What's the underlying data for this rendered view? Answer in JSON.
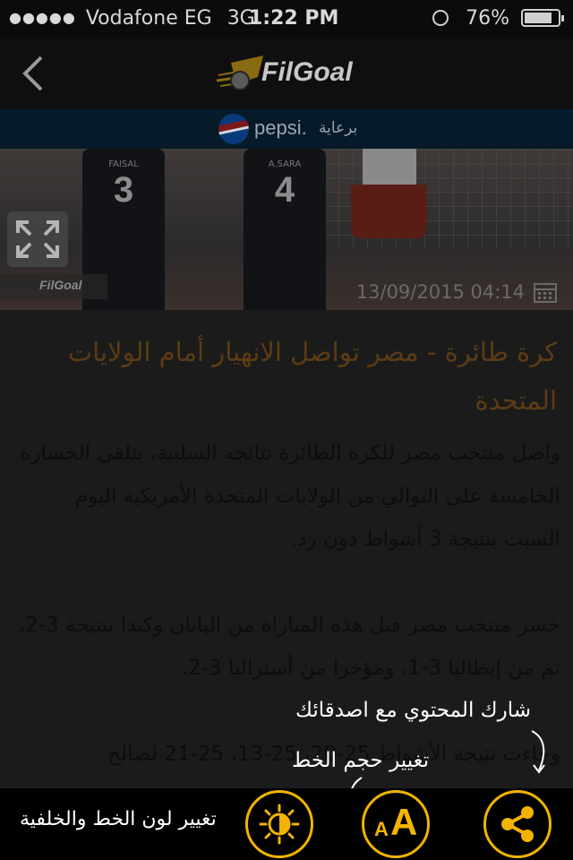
{
  "status_bar": {
    "carrier": "Vodafone EG",
    "network": "3G",
    "time": "1:22 PM",
    "battery": "76%"
  },
  "nav": {
    "logo_text": "FilGoal",
    "back_icon": "chevron-left-icon"
  },
  "sponsor": {
    "label": "برعاية",
    "brand": "pepsi."
  },
  "image": {
    "player_numbers": [
      "3",
      "4"
    ],
    "player_names": [
      "FAISAL",
      "A.SARA"
    ],
    "watermark": "FilGoal",
    "date": "13/09/2015 04:14"
  },
  "article": {
    "title": "كرة طائرة - مصر تواصل الانهيار أمام الولايات المتحدة",
    "body": "واصل منتخب مصر للكرة الطائرة نتائجه السلبية، بتلقي الخسارة الخامسة على التوالي من الولايات المتحدة الأمريكية اليوم السبت بنتيجة 3 أشواط دون رد.\n\nخسر منتخب مصر قبل هذه المباراة من اليابان وكندا بنتيجة 3-2، ثم من إيطاليا 3-1، ومؤخرا من أستراليا 3-2.\n\nوجاءت نتيجة الأشواط 25-20، 25-13، 25-21 لصالح"
  },
  "hints": {
    "share": "شارك المحتوي مع اصدقائك",
    "font_size": "تغيير حجم الخط",
    "theme": "تغيير لون الخط والخلفية"
  },
  "toolbar": {
    "theme_icon": "brightness-icon",
    "font_icon": "font-size-icon",
    "font_small": "A",
    "font_large": "A",
    "share_icon": "share-icon",
    "accent_color": "#f2b400"
  }
}
